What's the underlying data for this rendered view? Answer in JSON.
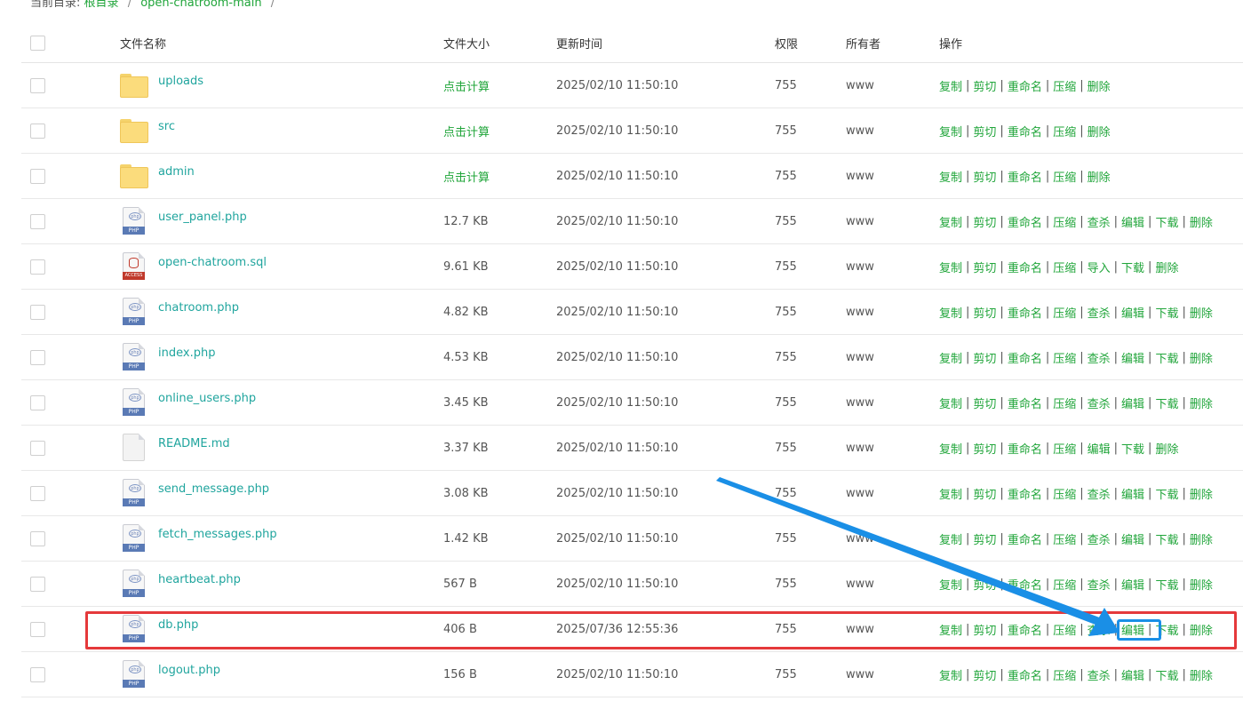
{
  "breadcrumb": {
    "prefix": "当前目录:",
    "root": "根目录",
    "folder": "open-chatroom-main",
    "sep": "/"
  },
  "columns": {
    "name": "文件名称",
    "size": "文件大小",
    "time": "更新时间",
    "perm": "权限",
    "owner": "所有者",
    "ops": "操作"
  },
  "op_labels": {
    "copy": "复制",
    "cut": "剪切",
    "rename": "重命名",
    "compress": "压缩",
    "scan": "查杀",
    "edit": "编辑",
    "download": "下载",
    "delete": "删除",
    "import": "导入"
  },
  "files": [
    {
      "name": "uploads",
      "icon": "folder-icon",
      "size": "点击计算",
      "time": "2025/02/10 11:50:10",
      "perm": "755",
      "owner": "www",
      "ops": [
        "copy",
        "cut",
        "rename",
        "compress",
        "delete"
      ]
    },
    {
      "name": "src",
      "icon": "folder-icon",
      "size": "点击计算",
      "time": "2025/02/10 11:50:10",
      "perm": "755",
      "owner": "www",
      "ops": [
        "copy",
        "cut",
        "rename",
        "compress",
        "delete"
      ]
    },
    {
      "name": "admin",
      "icon": "folder-icon",
      "size": "点击计算",
      "time": "2025/02/10 11:50:10",
      "perm": "755",
      "owner": "www",
      "ops": [
        "copy",
        "cut",
        "rename",
        "compress",
        "delete"
      ]
    },
    {
      "name": "user_panel.php",
      "icon": "php-file-icon",
      "size": "12.7 KB",
      "time": "2025/02/10 11:50:10",
      "perm": "755",
      "owner": "www",
      "ops": [
        "copy",
        "cut",
        "rename",
        "compress",
        "scan",
        "edit",
        "download",
        "delete"
      ]
    },
    {
      "name": "open-chatroom.sql",
      "icon": "sql-file-icon",
      "size": "9.61 KB",
      "time": "2025/02/10 11:50:10",
      "perm": "755",
      "owner": "www",
      "ops": [
        "copy",
        "cut",
        "rename",
        "compress",
        "import",
        "download",
        "delete"
      ]
    },
    {
      "name": "chatroom.php",
      "icon": "php-file-icon",
      "size": "4.82 KB",
      "time": "2025/02/10 11:50:10",
      "perm": "755",
      "owner": "www",
      "ops": [
        "copy",
        "cut",
        "rename",
        "compress",
        "scan",
        "edit",
        "download",
        "delete"
      ]
    },
    {
      "name": "index.php",
      "icon": "php-file-icon",
      "size": "4.53 KB",
      "time": "2025/02/10 11:50:10",
      "perm": "755",
      "owner": "www",
      "ops": [
        "copy",
        "cut",
        "rename",
        "compress",
        "scan",
        "edit",
        "download",
        "delete"
      ]
    },
    {
      "name": "online_users.php",
      "icon": "php-file-icon",
      "size": "3.45 KB",
      "time": "2025/02/10 11:50:10",
      "perm": "755",
      "owner": "www",
      "ops": [
        "copy",
        "cut",
        "rename",
        "compress",
        "scan",
        "edit",
        "download",
        "delete"
      ]
    },
    {
      "name": "README.md",
      "icon": "md-file-icon",
      "size": "3.37 KB",
      "time": "2025/02/10 11:50:10",
      "perm": "755",
      "owner": "www",
      "ops": [
        "copy",
        "cut",
        "rename",
        "compress",
        "edit",
        "download",
        "delete"
      ]
    },
    {
      "name": "send_message.php",
      "icon": "php-file-icon",
      "size": "3.08 KB",
      "time": "2025/02/10 11:50:10",
      "perm": "755",
      "owner": "www",
      "ops": [
        "copy",
        "cut",
        "rename",
        "compress",
        "scan",
        "edit",
        "download",
        "delete"
      ]
    },
    {
      "name": "fetch_messages.php",
      "icon": "php-file-icon",
      "size": "1.42 KB",
      "time": "2025/02/10 11:50:10",
      "perm": "755",
      "owner": "www",
      "ops": [
        "copy",
        "cut",
        "rename",
        "compress",
        "scan",
        "edit",
        "download",
        "delete"
      ]
    },
    {
      "name": "heartbeat.php",
      "icon": "php-file-icon",
      "size": "567 B",
      "time": "2025/02/10 11:50:10",
      "perm": "755",
      "owner": "www",
      "ops": [
        "copy",
        "cut",
        "rename",
        "compress",
        "scan",
        "edit",
        "download",
        "delete"
      ]
    },
    {
      "name": "db.php",
      "icon": "php-file-icon",
      "size": "406 B",
      "time": "2025/07/36 12:55:36",
      "perm": "755",
      "owner": "www",
      "ops": [
        "copy",
        "cut",
        "rename",
        "compress",
        "scan",
        "edit",
        "download",
        "delete"
      ],
      "highlighted": true
    },
    {
      "name": "logout.php",
      "icon": "php-file-icon",
      "size": "156 B",
      "time": "2025/02/10 11:50:10",
      "perm": "755",
      "owner": "www",
      "ops": [
        "copy",
        "cut",
        "rename",
        "compress",
        "scan",
        "edit",
        "download",
        "delete"
      ]
    }
  ],
  "icon_text": {
    "php": "PHP",
    "php_small": "php",
    "sql": "ACCESS"
  },
  "colors": {
    "link": "#20a53a",
    "filename": "#20a59e",
    "highlight": "#e5393b",
    "arrow": "#1a8fe6"
  }
}
